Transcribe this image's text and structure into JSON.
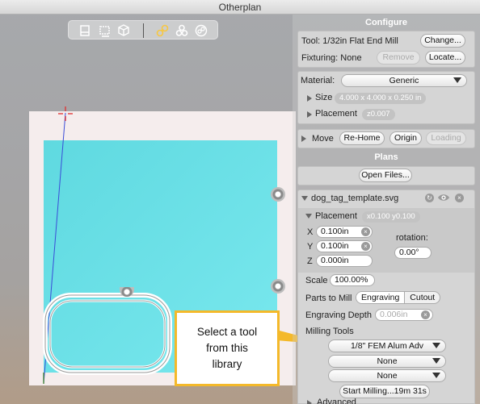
{
  "window": {
    "title": "Otherplan"
  },
  "view_toolbar": {
    "icons": [
      "top-view-icon",
      "perspective-view-icon",
      "3d-box-view-icon",
      "linked-rings-icon",
      "rings-group-icon",
      "rings-outline-icon"
    ]
  },
  "configure": {
    "header": "Configure",
    "tool_label": "Tool: 1/32in Flat End Mill",
    "change_button": "Change...",
    "fixturing_label": "Fixturing: None",
    "remove_button": "Remove",
    "locate_button": "Locate...",
    "material_label": "Material:",
    "material_value": "Generic",
    "size_label": "Size",
    "size_value": "4.000 x 4.000 x 0.250 in",
    "placement_label": "Placement",
    "placement_value": "z0.007",
    "move_label": "Move",
    "rehome_button": "Re-Home",
    "origin_button": "Origin",
    "loading_button": "Loading"
  },
  "plans": {
    "header": "Plans",
    "open_files_button": "Open Files...",
    "file_name": "dog_tag_template.svg",
    "placement_label": "Placement",
    "placement_value": "x0.100 y0.100",
    "x_label": "X",
    "x_value": "0.100in",
    "y_label": "Y",
    "y_value": "0.100in",
    "z_label": "Z",
    "z_value": "0.000in",
    "rotation_label": "rotation:",
    "rotation_value": "0.00°",
    "scale_label": "Scale",
    "scale_value": "100.00%",
    "parts_label": "Parts to Mill",
    "parts_options": [
      "Engraving",
      "Cutout"
    ],
    "engraving_depth_label": "Engraving Depth",
    "engraving_depth_placeholder": "0.006in",
    "milling_tools_label": "Milling Tools",
    "tool_1": "1/8\" FEM Alum Adv",
    "tool_2": "None",
    "tool_3": "None",
    "start_button": "Start Milling...19m 31s",
    "advanced_label": "Advanced"
  },
  "callout": {
    "lines": [
      "Select a tool",
      "from this",
      "library"
    ]
  },
  "colors": {
    "stock": "#6ee3ea",
    "board": "#f5eded",
    "callout_border": "#f4b92a",
    "active_icon": "#f7c742"
  }
}
